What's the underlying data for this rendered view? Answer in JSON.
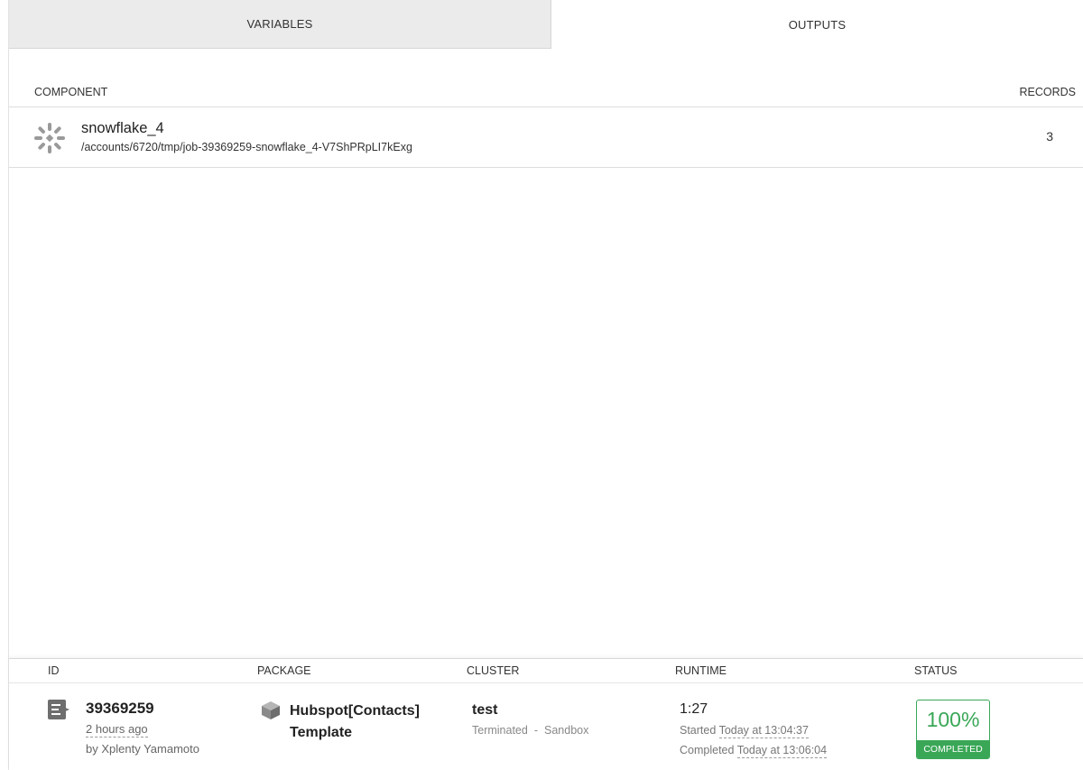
{
  "tabs": {
    "variables": "VARIABLES",
    "outputs": "OUTPUTS"
  },
  "outputs_table": {
    "headers": {
      "component": "COMPONENT",
      "records": "RECORDS"
    },
    "rows": [
      {
        "icon": "snowflake-icon",
        "name": "snowflake_4",
        "path": "/accounts/6720/tmp/job-39369259-snowflake_4-V7ShPRpLI7kExg",
        "records": "3"
      }
    ]
  },
  "job": {
    "headers": {
      "id": "ID",
      "package": "PACKAGE",
      "cluster": "CLUSTER",
      "runtime": "RUNTIME",
      "status": "STATUS"
    },
    "id": "39369259",
    "ago": "2 hours ago",
    "by": "by Xplenty Yamamoto",
    "package": {
      "icon": "package-cube-icon",
      "name": "Hubspot[Contacts] Template"
    },
    "cluster": {
      "name": "test",
      "state": "Terminated",
      "separator": "-",
      "type": "Sandbox"
    },
    "runtime": {
      "duration": "1:27",
      "started_label": "Started",
      "started_value": "Today at 13:04:37",
      "completed_label": "Completed",
      "completed_value": "Today at 13:06:04"
    },
    "status": {
      "percent": "100%",
      "label": "COMPLETED",
      "progress_fraction": 1.0,
      "color": "#3aa757"
    }
  }
}
